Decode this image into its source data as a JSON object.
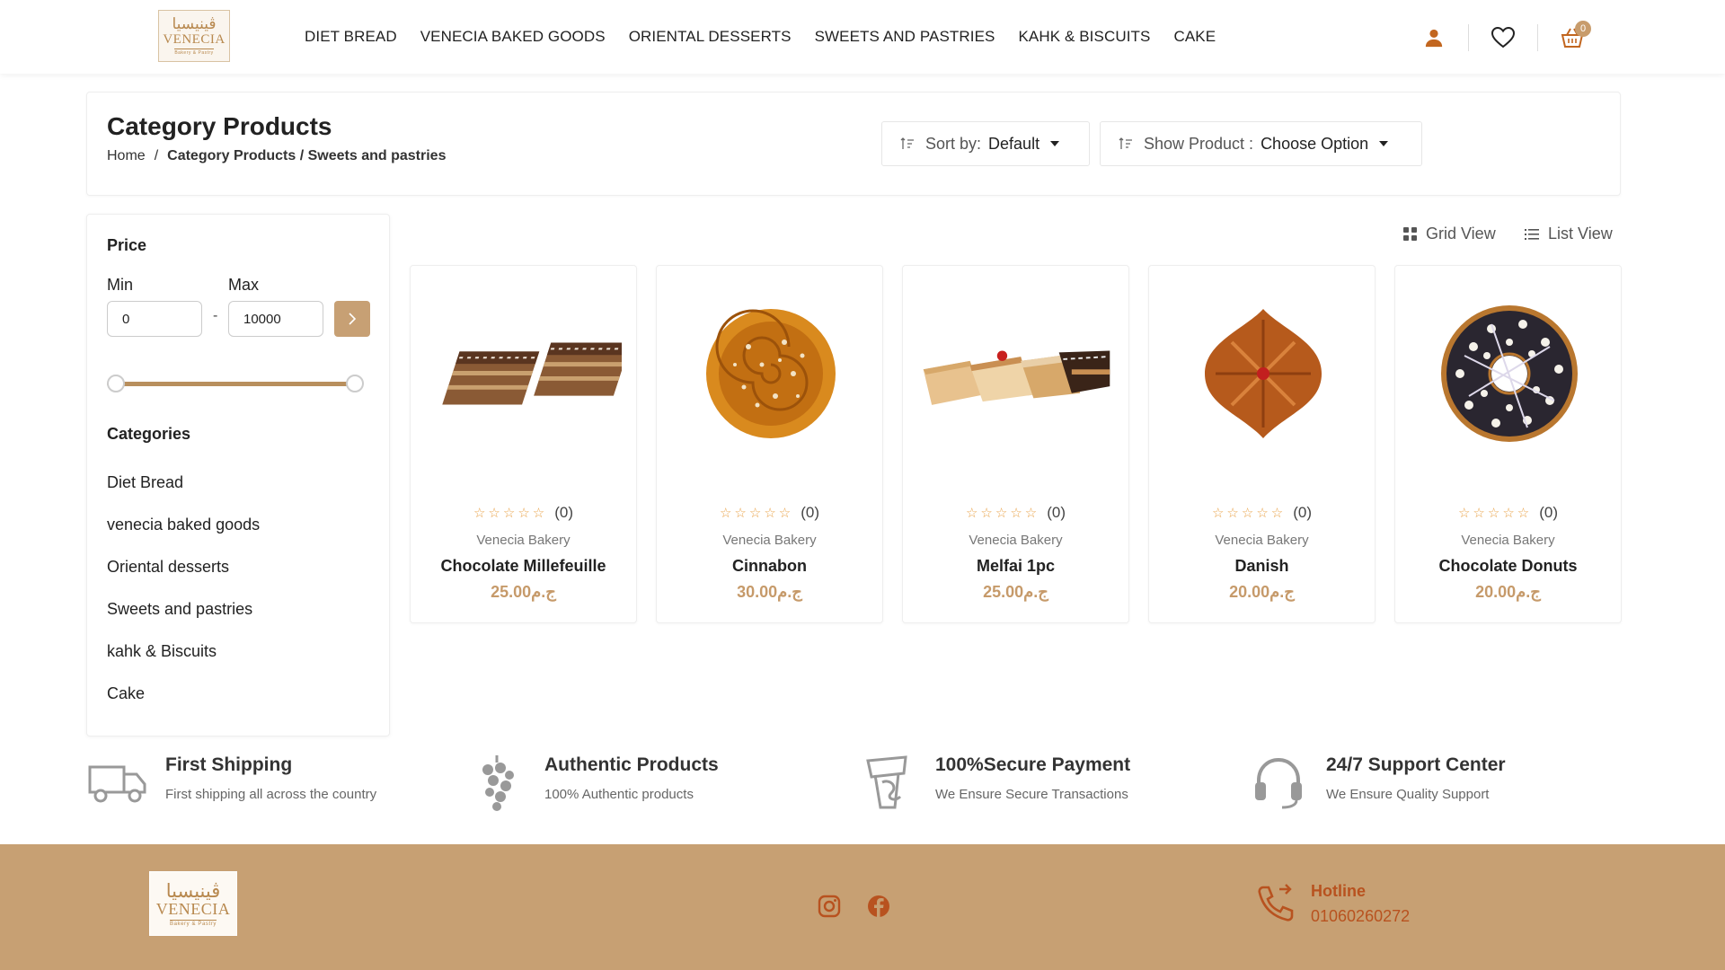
{
  "logo": {
    "arabic": "ڤينيسيا",
    "name": "VENECIA",
    "tagline": "Bakery & Pastry"
  },
  "nav": [
    {
      "label": "DIET BREAD"
    },
    {
      "label": "VENECIA BAKED GOODS"
    },
    {
      "label": "ORIENTAL DESSERTS"
    },
    {
      "label": "SWEETS AND PASTRIES"
    },
    {
      "label": "KAHK & BISCUITS"
    },
    {
      "label": "CAKE"
    }
  ],
  "header_icons": {
    "account": "user-icon",
    "wishlist": "heart-icon",
    "cart": "basket-icon",
    "cart_count": "0"
  },
  "page": {
    "title": "Category Products",
    "breadcrumb": {
      "home": "Home",
      "sep": "/",
      "current": "Category Products / Sweets and pastries"
    },
    "sort": {
      "label": "Sort by:",
      "value": "Default"
    },
    "show": {
      "label": "Show Product :",
      "value": "Choose Option"
    }
  },
  "filters": {
    "price_heading": "Price",
    "min_label": "Min",
    "max_label": "Max",
    "min_value": "0",
    "max_value": "10000",
    "dash": "-",
    "categories_heading": "Categories",
    "categories": [
      "Diet Bread",
      "venecia baked goods",
      "Oriental desserts",
      "Sweets and pastries",
      "kahk & Biscuits",
      "Cake"
    ]
  },
  "views": {
    "grid": "Grid View",
    "list": "List View"
  },
  "products": [
    {
      "name": "Chocolate Millefeuille",
      "brand": "Venecia Bakery",
      "price": "25.00ج.م",
      "reviews": "(0)",
      "rating": 0
    },
    {
      "name": "Cinnabon",
      "brand": "Venecia Bakery",
      "price": "30.00ج.م",
      "reviews": "(0)",
      "rating": 0
    },
    {
      "name": "Melfai 1pc",
      "brand": "Venecia Bakery",
      "price": "25.00ج.م",
      "reviews": "(0)",
      "rating": 0
    },
    {
      "name": "Danish",
      "brand": "Venecia Bakery",
      "price": "20.00ج.م",
      "reviews": "(0)",
      "rating": 0
    },
    {
      "name": "Chocolate Donuts",
      "brand": "Venecia Bakery",
      "price": "20.00ج.م",
      "reviews": "(0)",
      "rating": 0
    }
  ],
  "features": [
    {
      "title": "First Shipping",
      "subtitle": "First shipping all across the country",
      "icon": "truck-icon"
    },
    {
      "title": "Authentic Products",
      "subtitle": "100% Authentic products",
      "icon": "grapes-icon"
    },
    {
      "title": "100%Secure Payment",
      "subtitle": "We Ensure Secure Transactions",
      "icon": "payment-icon"
    },
    {
      "title": "24/7 Support Center",
      "subtitle": "We Ensure Quality Support",
      "icon": "headset-icon"
    }
  ],
  "footer": {
    "hotline_label": "Hotline",
    "hotline_number": "01060260272",
    "social": [
      "instagram-icon",
      "facebook-icon"
    ]
  },
  "colors": {
    "accent": "#c7a073",
    "price": "#c69a6a",
    "hotline": "#b8521f",
    "star": "#e9a34a"
  }
}
